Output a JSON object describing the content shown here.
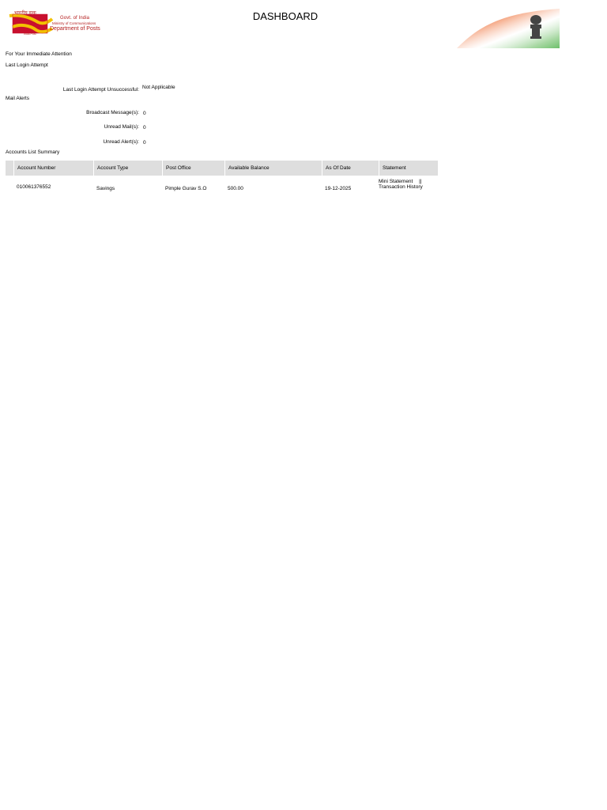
{
  "header": {
    "logo": {
      "hindi_text": "भारतीय डाक",
      "govt": "Govt. of India",
      "ministry": "Ministry of Communications",
      "department": "Department of Posts",
      "small_text": "India Post"
    },
    "title": "DASHBOARD",
    "emblem": "national-emblem"
  },
  "attention": {
    "heading": "For Your Immediate Attention",
    "last_login_heading": "Last Login Attempt",
    "last_login_unsuccessful_label": "Last Login Attempt Unsuccessful:",
    "last_login_unsuccessful_value": "Not Applicable"
  },
  "mail_alerts": {
    "heading": "Mail Alerts",
    "broadcast_label": "Broadcast Message(s):",
    "broadcast_value": "0",
    "unread_mail_label": "Unread Mail(s):",
    "unread_mail_value": "0",
    "unread_alert_label": "Unread Alert(s):",
    "unread_alert_value": "0"
  },
  "accounts": {
    "heading": "Accounts List Summary",
    "columns": [
      "Account Number",
      "Account Type",
      "Post Office",
      "Available Balance",
      "As Of Date",
      "Statement"
    ],
    "rows": [
      {
        "account_number": "010061376552",
        "account_type": "Savings",
        "post_office": "Pimple Gurav S.O",
        "available_balance": "500.00",
        "as_of_date": "19-12-2025",
        "mini_statement": "Mini Statement",
        "separator": "||",
        "transaction_history": "Transaction History"
      }
    ]
  },
  "colors": {
    "logo_red": "#b31b1b",
    "logo_yellow": "#f2c100",
    "table_header_bg": "#dedede"
  }
}
